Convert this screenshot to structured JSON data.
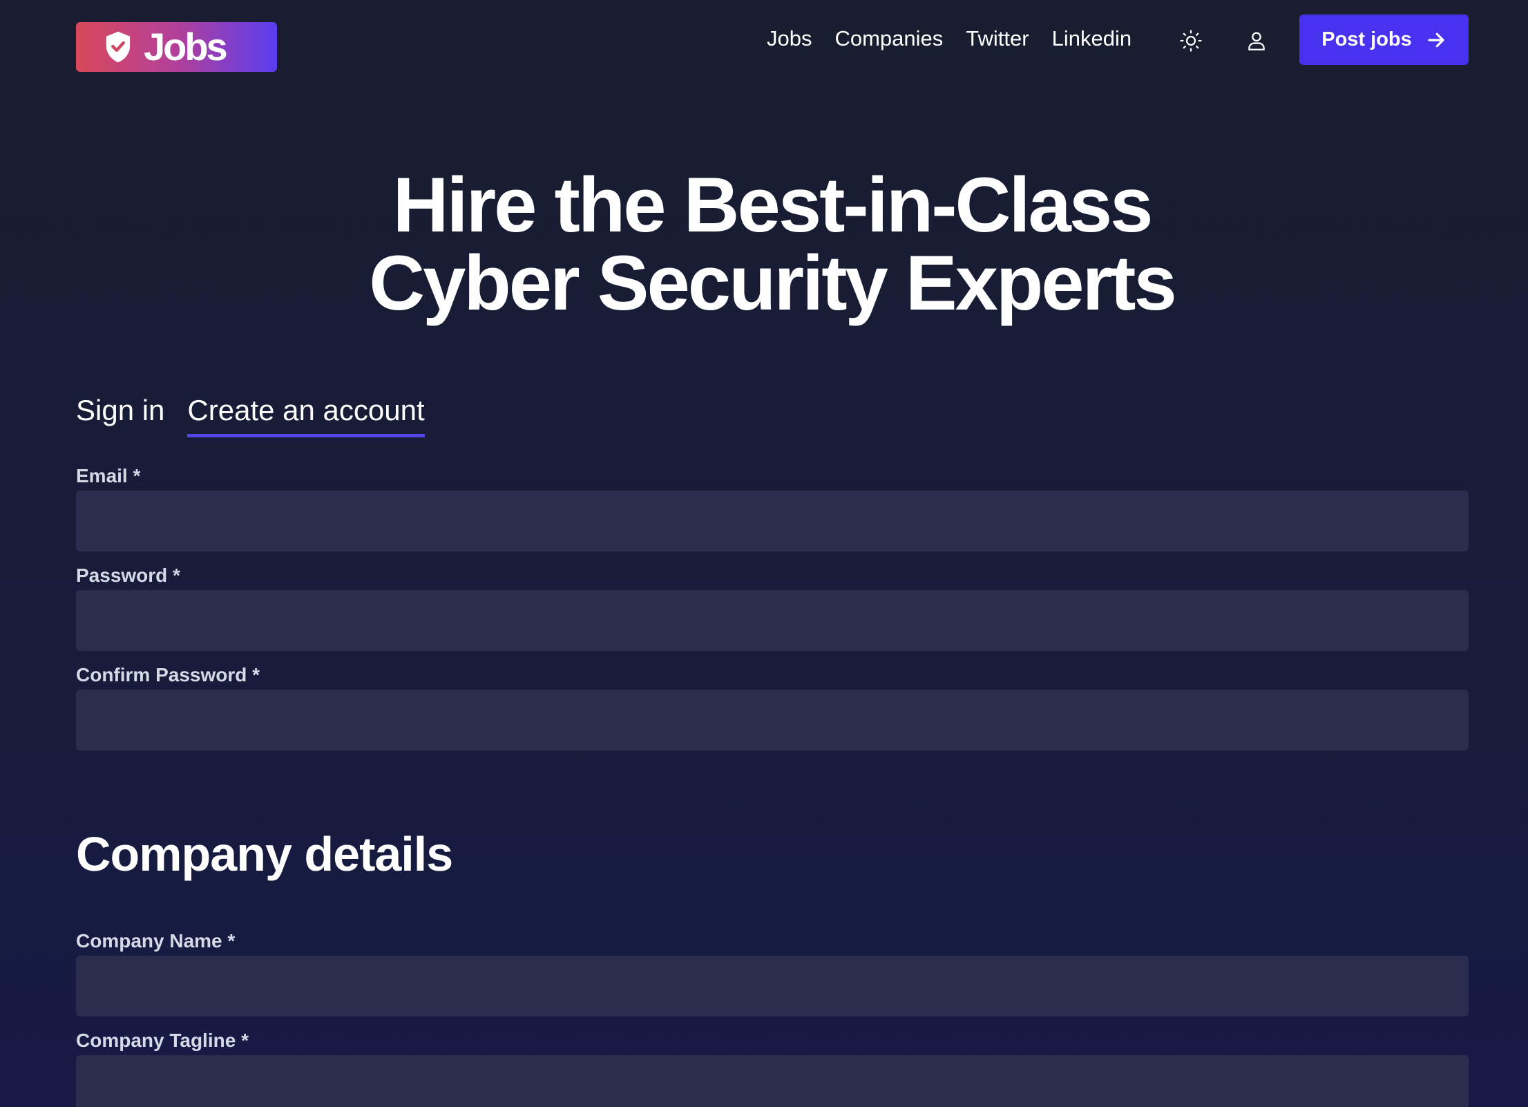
{
  "brand": {
    "name": "Jobs"
  },
  "nav": {
    "items": [
      {
        "label": "Jobs"
      },
      {
        "label": "Companies"
      },
      {
        "label": "Twitter"
      },
      {
        "label": "Linkedin"
      }
    ],
    "post_jobs_label": "Post jobs",
    "icons": [
      "sun-icon",
      "user-icon",
      "arrow-right-icon",
      "shield-check-icon"
    ]
  },
  "hero": {
    "line1": "Hire the Best-in-Class",
    "line2": "Cyber Security Experts"
  },
  "tabs": [
    {
      "label": "Sign in",
      "active": false
    },
    {
      "label": "Create an account",
      "active": true
    }
  ],
  "account_form": {
    "email_label": "Email *",
    "email_value": "",
    "password_label": "Password *",
    "password_value": "",
    "confirm_password_label": "Confirm Password *",
    "confirm_password_value": ""
  },
  "company": {
    "title": "Company details",
    "name_label": "Company Name *",
    "name_value": "",
    "tagline_label": "Company Tagline *",
    "tagline_value": ""
  },
  "colors": {
    "accent": "#4733ef",
    "tab_underline": "#4f46e5",
    "input_bg": "#2b2d4f",
    "logo_gradient_start": "#d9485a",
    "logo_gradient_end": "#5b3df0"
  }
}
